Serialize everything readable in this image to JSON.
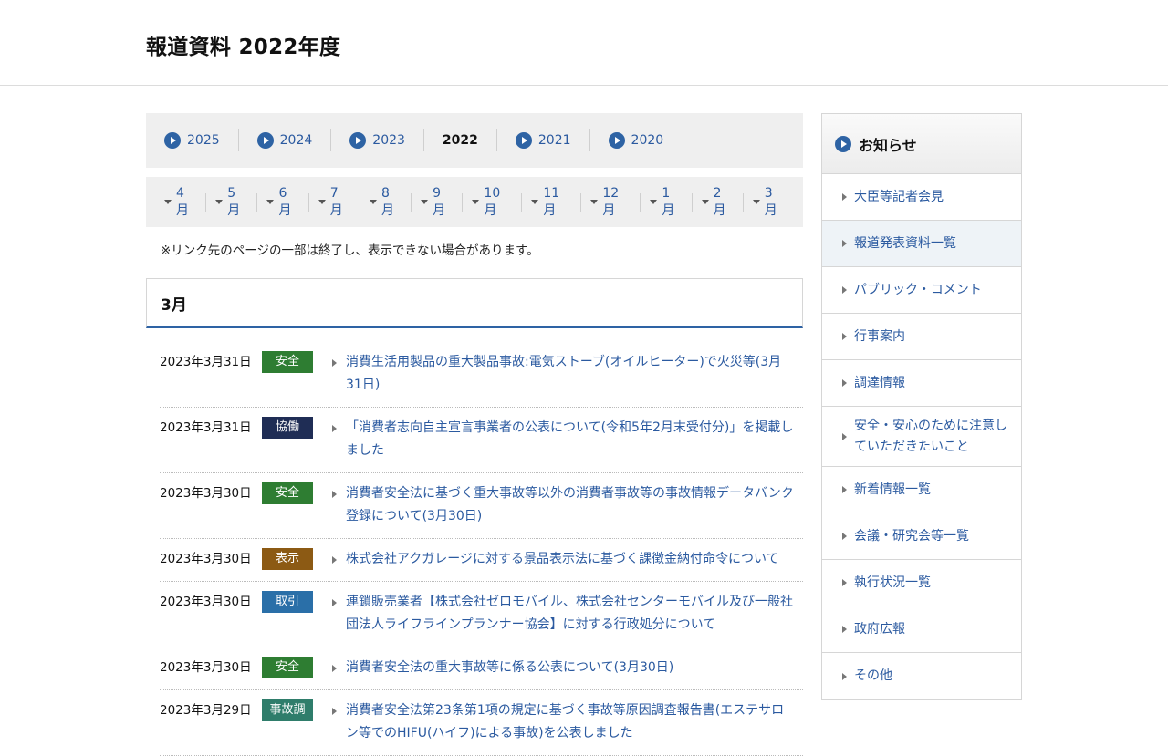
{
  "header": {
    "title": "報道資料 2022年度"
  },
  "year_nav": [
    {
      "label": "2025",
      "current": false
    },
    {
      "label": "2024",
      "current": false
    },
    {
      "label": "2023",
      "current": false
    },
    {
      "label": "2022",
      "current": true
    },
    {
      "label": "2021",
      "current": false
    },
    {
      "label": "2020",
      "current": false
    }
  ],
  "month_nav": [
    "4月",
    "5月",
    "6月",
    "7月",
    "8月",
    "9月",
    "10月",
    "11月",
    "12月",
    "1月",
    "2月",
    "3月"
  ],
  "notice": "※リンク先のページの一部は終了し、表示できない場合があります。",
  "section_heading": "3月",
  "badge_colors": {
    "安全": "#2e7d32",
    "協働": "#1f2d55",
    "表示": "#8c5a14",
    "取引": "#2a6fa8",
    "事故調": "#2f7d6b"
  },
  "news": [
    {
      "date": "2023年3月31日",
      "badge": "安全",
      "title": "消費生活用製品の重大製品事故:電気ストーブ(オイルヒーター)で火災等(3月31日)"
    },
    {
      "date": "2023年3月31日",
      "badge": "協働",
      "title": "「消費者志向自主宣言事業者の公表について(令和5年2月末受付分)」を掲載しました"
    },
    {
      "date": "2023年3月30日",
      "badge": "安全",
      "title": "消費者安全法に基づく重大事故等以外の消費者事故等の事故情報データバンク登録について(3月30日)"
    },
    {
      "date": "2023年3月30日",
      "badge": "表示",
      "title": "株式会社アクガレージに対する景品表示法に基づく課徴金納付命令について"
    },
    {
      "date": "2023年3月30日",
      "badge": "取引",
      "title": "連鎖販売業者【株式会社ゼロモバイル、株式会社センターモバイル及び一般社団法人ライフラインプランナー協会】に対する行政処分について"
    },
    {
      "date": "2023年3月30日",
      "badge": "安全",
      "title": "消費者安全法の重大事故等に係る公表について(3月30日)"
    },
    {
      "date": "2023年3月29日",
      "badge": "事故調",
      "title": "消費者安全法第23条第1項の規定に基づく事故等原因調査報告書(エステサロン等でのHIFU(ハイフ)による事故)を公表しました"
    }
  ],
  "sidebar": {
    "heading": "お知らせ",
    "items": [
      {
        "label": "大臣等記者会見",
        "active": false
      },
      {
        "label": "報道発表資料一覧",
        "active": true
      },
      {
        "label": "パブリック・コメント",
        "active": false
      },
      {
        "label": "行事案内",
        "active": false
      },
      {
        "label": "調達情報",
        "active": false
      },
      {
        "label": "安全・安心のために注意していただきたいこと",
        "active": false
      },
      {
        "label": "新着情報一覧",
        "active": false
      },
      {
        "label": "会議・研究会等一覧",
        "active": false
      },
      {
        "label": "執行状況一覧",
        "active": false
      },
      {
        "label": "政府広報",
        "active": false
      },
      {
        "label": "その他",
        "active": false
      }
    ]
  }
}
